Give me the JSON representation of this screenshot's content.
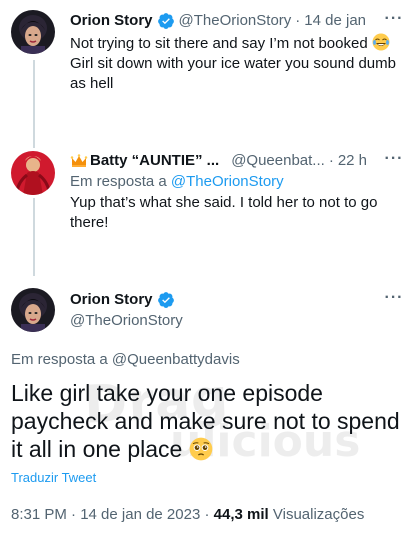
{
  "tweet1": {
    "name": "Orion Story",
    "handle": "@TheOrionStory",
    "time": "14 de jan",
    "text_line1": "Not trying to sit there and say I’m not booked",
    "text_line2": "Girl sit down with your ice water you sound dumb",
    "text_line3": "as hell",
    "emoji": "crying-laughing-emoji"
  },
  "tweet2": {
    "name": "Batty “AUNTIE” ...",
    "handle": "@Queenbat...",
    "time": "22 h",
    "reply_prefix": "Em resposta a",
    "reply_handle": "@TheOrionStory",
    "text_line1": "Yup that’s what she said. I told her to not to go",
    "text_line2": "there!",
    "emoji": "crown-emoji"
  },
  "main_tweet": {
    "name": "Orion Story",
    "handle": "@TheOrionStory",
    "reply_prefix": "Em resposta a",
    "reply_handle": "@Queenbattydavis",
    "text_line1": "Like girl take your one episode",
    "text_line2": "paycheck and make sure not to spend",
    "text_line3": "it all in one place",
    "emoji": "pleading-face-emoji",
    "translate_label": "Traduzir Tweet",
    "timestamp": "8:31 PM · 14 de jan de 2023",
    "views_count": "44,3 mil",
    "views_label": "Visualizações"
  },
  "watermark": {
    "line1": "Drag",
    "line2": "ulicious"
  },
  "colors": {
    "link": "#1d9bf0",
    "secondary_text": "#536471",
    "primary_text": "#0f1419",
    "verified": "#1d9bf0",
    "thread_line": "#cfd9de"
  }
}
